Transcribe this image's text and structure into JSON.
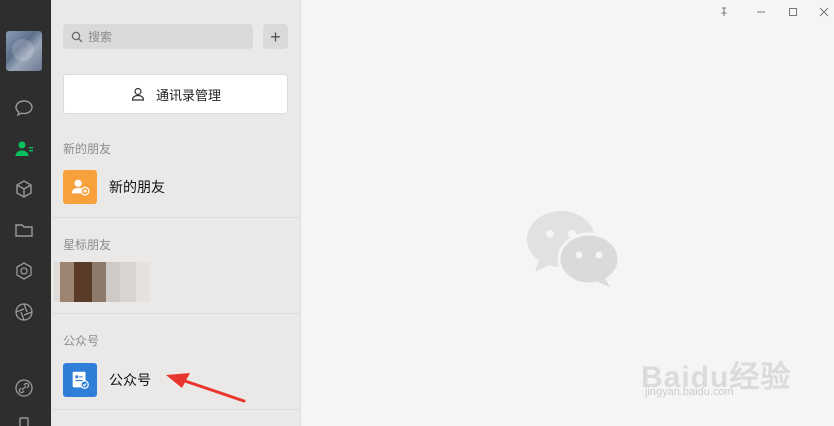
{
  "search": {
    "placeholder": "搜索"
  },
  "add_button": {
    "label": "+"
  },
  "manage_button": {
    "label": "通讯录管理"
  },
  "sections": {
    "new_friends": {
      "title": "新的朋友",
      "item_label": "新的朋友"
    },
    "starred": {
      "title": "星标朋友"
    },
    "official_accounts": {
      "title": "公众号",
      "item_label": "公众号"
    }
  },
  "colors": {
    "rail_bg": "#2e2e2e",
    "active_icon": "#07c160",
    "new_friend_icon_bg": "#f7a03c",
    "official_icon_bg": "#2f7fd8",
    "arrow": "#e8362c"
  },
  "watermark": {
    "text": "Baidu经验",
    "url_text": "jingyan.baidu.com"
  },
  "rail_icons": [
    "chat-icon",
    "contacts-icon",
    "box-icon",
    "folder-icon",
    "moments-icon",
    "aperture-icon",
    "link-icon",
    "phone-icon"
  ]
}
